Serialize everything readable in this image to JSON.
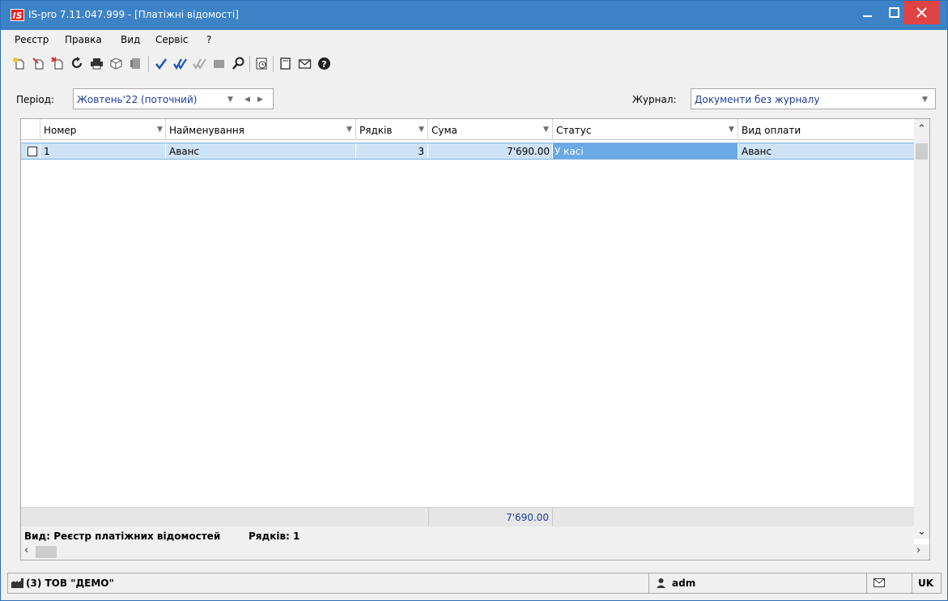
{
  "window": {
    "title": "IS-pro 7.11.047.999 - [Платіжні відомості]",
    "app_icon_text": "IS",
    "minimize_label": "_",
    "maximize_label": "□",
    "close_label": "✕"
  },
  "menu": {
    "items": [
      "Реєстр",
      "Правка",
      "Вид",
      "Сервіс",
      "?"
    ]
  },
  "toolbar": {
    "icons": [
      "new-doc-icon",
      "edit-doc-icon",
      "delete-doc-icon",
      "refresh-icon",
      "print-icon",
      "export-icon",
      "stamp-icon",
      "check-icon",
      "double-check-icon",
      "uncheck-icon",
      "block-icon",
      "search-icon",
      "history-icon",
      "form-icon",
      "mail-icon",
      "help-icon"
    ]
  },
  "filters": {
    "period_label": "Період:",
    "period_value": "Жовтень'22 (поточний)",
    "journal_label": "Журнал:",
    "journal_value": "Документи без журналу"
  },
  "grid": {
    "columns": [
      "Номер",
      "Найменування",
      "Рядків",
      "Сума",
      "Статус",
      "Вид оплати"
    ],
    "rows": [
      {
        "number": "1",
        "name": "Аванс",
        "rows_count": "3",
        "sum": "7'690.00",
        "status": "У касі",
        "payment_type": "Аванс"
      }
    ],
    "footer_sum": "7'690.00",
    "view_label": "Вид: Реєстр платіжних відомостей",
    "rows_label": "Рядків: 1"
  },
  "statusbar": {
    "company": "(3) ТОВ \"ДЕМО\"",
    "user": "adm",
    "language": "UK"
  },
  "colors": {
    "titlebar": "#3c82c6",
    "selected_row": "#cfe3f7",
    "status_highlight": "#6aa8e6",
    "link_text": "#1c3d9a"
  }
}
